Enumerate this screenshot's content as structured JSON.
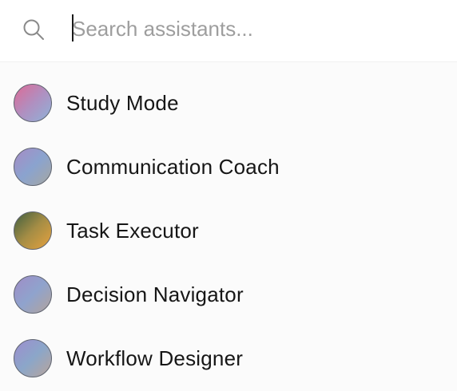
{
  "search": {
    "placeholder": "Search assistants...",
    "value": "",
    "icon": "search-icon"
  },
  "assistants": [
    {
      "label": "Study Mode",
      "avatar_colors": [
        "#de6a95",
        "#b08fc0",
        "#8fb2d8"
      ]
    },
    {
      "label": "Communication Coach",
      "avatar_colors": [
        "#a78bc4",
        "#8aa3cf",
        "#a6a7a0"
      ]
    },
    {
      "label": "Task Executor",
      "avatar_colors": [
        "#3f5e3f",
        "#a58d45",
        "#e7a23e"
      ]
    },
    {
      "label": "Decision Navigator",
      "avatar_colors": [
        "#a08cc6",
        "#8fa3cd",
        "#b3a39b"
      ]
    },
    {
      "label": "Workflow Designer",
      "avatar_colors": [
        "#9d8dce",
        "#8ba6c9",
        "#b9a49a"
      ]
    }
  ]
}
